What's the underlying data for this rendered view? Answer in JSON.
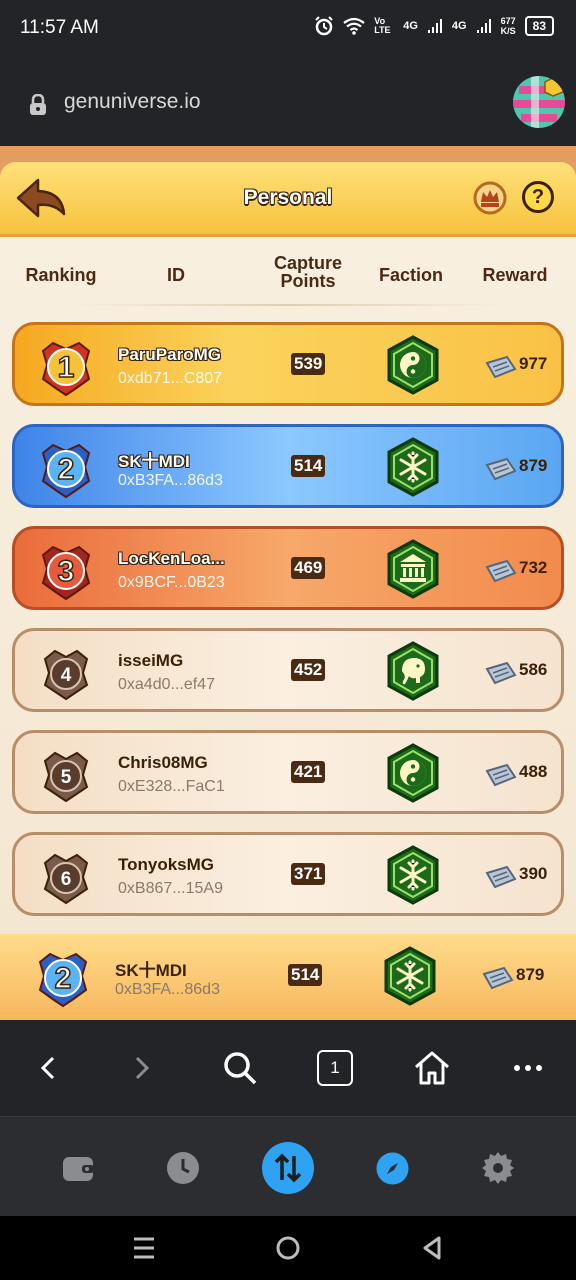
{
  "status_bar": {
    "time": "11:57 AM",
    "indicators": [
      "alarm-icon",
      "wifi-icon",
      "Vo LTE",
      "4G",
      "4G",
      "677 K/S"
    ],
    "network_speed": "677",
    "network_speed_unit": "K/S",
    "volte": "Vo LTE",
    "signal_1": "4G",
    "signal_2": "4G",
    "battery": "83"
  },
  "browser": {
    "url": "genuniverse.io",
    "nav": {
      "back_icon": "chevron-left-icon",
      "forward_icon": "chevron-right-icon",
      "search_icon": "search-icon",
      "tab_count": "1",
      "home_icon": "home-icon",
      "more_icon": "more-icon"
    },
    "tabs": [
      "wallet-icon",
      "history-icon",
      "swap-icon",
      "discover-icon",
      "settings-icon"
    ]
  },
  "game": {
    "title": "Personal",
    "columns": {
      "ranking": "Ranking",
      "id": "ID",
      "capture_points_1": "Capture",
      "capture_points_2": "Points",
      "faction": "Faction",
      "reward": "Reward"
    },
    "rows": [
      {
        "rank": "1",
        "name": "ParuParoMG",
        "address": "0xdb71...C807",
        "points": "539",
        "faction": "yin-yang-icon",
        "reward": "977",
        "style": "gold"
      },
      {
        "rank": "2",
        "name": "SK十MDI",
        "address": "0xB3FA...86d3",
        "points": "514",
        "faction": "snowflake-icon",
        "reward": "879",
        "style": "blue"
      },
      {
        "rank": "3",
        "name": "LocKenLoa...",
        "address": "0x9BCF...0B23",
        "points": "469",
        "faction": "temple-icon",
        "reward": "732",
        "style": "orange"
      },
      {
        "rank": "4",
        "name": "isseiMG",
        "address": "0xa4d0...ef47",
        "points": "452",
        "faction": "elephant-icon",
        "reward": "586",
        "style": "plain"
      },
      {
        "rank": "5",
        "name": "Chris08MG",
        "address": "0xE328...FaC1",
        "points": "421",
        "faction": "yin-yang-icon",
        "reward": "488",
        "style": "plain"
      },
      {
        "rank": "6",
        "name": "TonyoksMG",
        "address": "0xB867...15A9",
        "points": "371",
        "faction": "snowflake-icon",
        "reward": "390",
        "style": "plain"
      }
    ],
    "my_row": {
      "rank": "2",
      "name": "SK十MDI",
      "address": "0xB3FA...86d3",
      "points": "514",
      "faction": "snowflake-icon",
      "reward": "879"
    }
  },
  "colors": {
    "gold": "#f6b93b",
    "blue": "#5aa6f2",
    "orange": "#f28b4c",
    "faction_green": "#1d6b1a",
    "accent": "#2ea3f2"
  }
}
